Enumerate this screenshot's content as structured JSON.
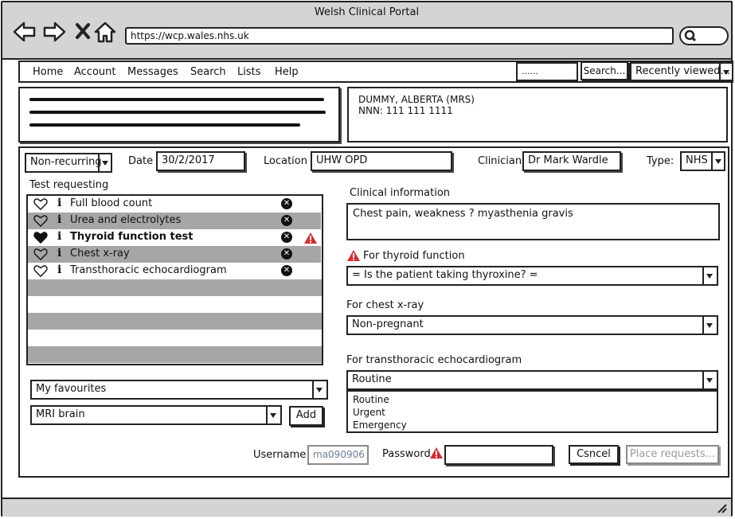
{
  "window": {
    "title": "Welsh Clinical Portal"
  },
  "browser": {
    "url": "https://wcp.wales.nhs.uk"
  },
  "menu": {
    "items": [
      "Home",
      "Account",
      "Messages",
      "Search",
      "Lists",
      "Help"
    ],
    "search_value": "......",
    "search_button": "Search...",
    "recent": "Recently viewed..."
  },
  "patient": {
    "name": "DUMMY, ALBERTA (MRS)",
    "nnn": "NNN: 111 111 1111"
  },
  "request": {
    "recurrence": "Non-recurring",
    "date_label": "Date",
    "date": "30/2/2017",
    "location_label": "Location",
    "location": "UHW OPD",
    "clinician_label": "Clinician",
    "clinician": "Dr Mark Wardle",
    "type_label": "Type:",
    "type": "NHS"
  },
  "tests": {
    "heading": "Test requesting",
    "items": [
      {
        "name": "Full blood count",
        "favourite": false,
        "warning": false,
        "bold": false
      },
      {
        "name": "Urea and electrolytes",
        "favourite": false,
        "warning": false,
        "bold": false
      },
      {
        "name": "Thyroid function test",
        "favourite": true,
        "warning": true,
        "bold": true
      },
      {
        "name": "Chest x-ray",
        "favourite": false,
        "warning": false,
        "bold": false
      },
      {
        "name": "Transthoracic echocardiogram",
        "favourite": false,
        "warning": false,
        "bold": false
      }
    ]
  },
  "favourites": {
    "select": "My favourites",
    "test_select": "MRI brain",
    "add": "Add"
  },
  "clinical": {
    "label": "Clinical information",
    "value": "Chest pain, weakness ? myasthenia gravis",
    "thyroid_label": "For thyroid function",
    "thyroid_value": "= Is the patient taking thyroxine? =",
    "xray_label": "For chest x-ray",
    "xray_value": "Non-pregnant",
    "echo_label": "For transthoracic echocardiogram",
    "echo_value": "Routine",
    "echo_options": [
      "Routine",
      "Urgent",
      "Emergency"
    ]
  },
  "auth": {
    "username_label": "Username",
    "username": "ma090906",
    "password_label": "Password",
    "cancel": "Csncel",
    "submit": "Place requests..."
  },
  "colors": {
    "warning": "#d62d2d",
    "row_grey": "#a6a6a6",
    "chrome": "#d4d4d4"
  }
}
